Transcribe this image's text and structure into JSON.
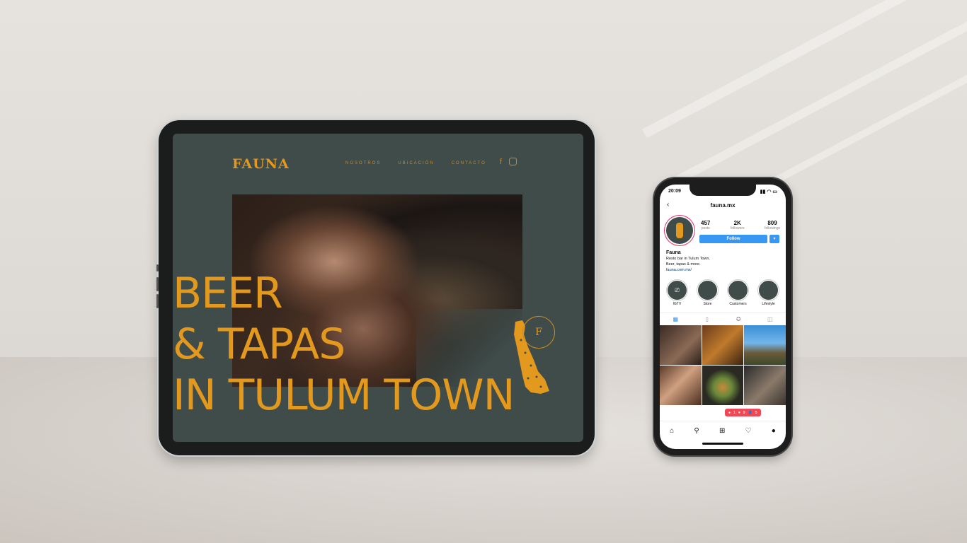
{
  "website": {
    "logo": "FAUNA",
    "nav": [
      "NOSOTROS",
      "UBICACIÓN",
      "CONTACTO"
    ],
    "social_icons": [
      "facebook-icon",
      "instagram-icon"
    ],
    "headline": [
      "BEER",
      "& TAPAS",
      "IN TULUM TOWN"
    ],
    "emblem_letter": "F",
    "colors": {
      "accent": "#e3981e",
      "background": "#3f4c4a"
    }
  },
  "instagram": {
    "status_time": "20:09",
    "username": "fauna.mx",
    "stats": [
      {
        "value": "457",
        "label": "posts"
      },
      {
        "value": "2K",
        "label": "followers"
      },
      {
        "value": "809",
        "label": "followings"
      }
    ],
    "follow_label": "Follow",
    "bio": {
      "name": "Fauna",
      "line1": "Resto bar in Tulum Town.",
      "line2": "Beer, tapas & more.",
      "link": "fauna.com.mx/"
    },
    "highlights": [
      "IGTV",
      "Store",
      "Customers",
      "Lifestyle"
    ],
    "notifications": {
      "comments": "1",
      "likes": "9",
      "follows": "5"
    },
    "colors": {
      "follow": "#3897f0",
      "notif": "#ed4956"
    }
  }
}
